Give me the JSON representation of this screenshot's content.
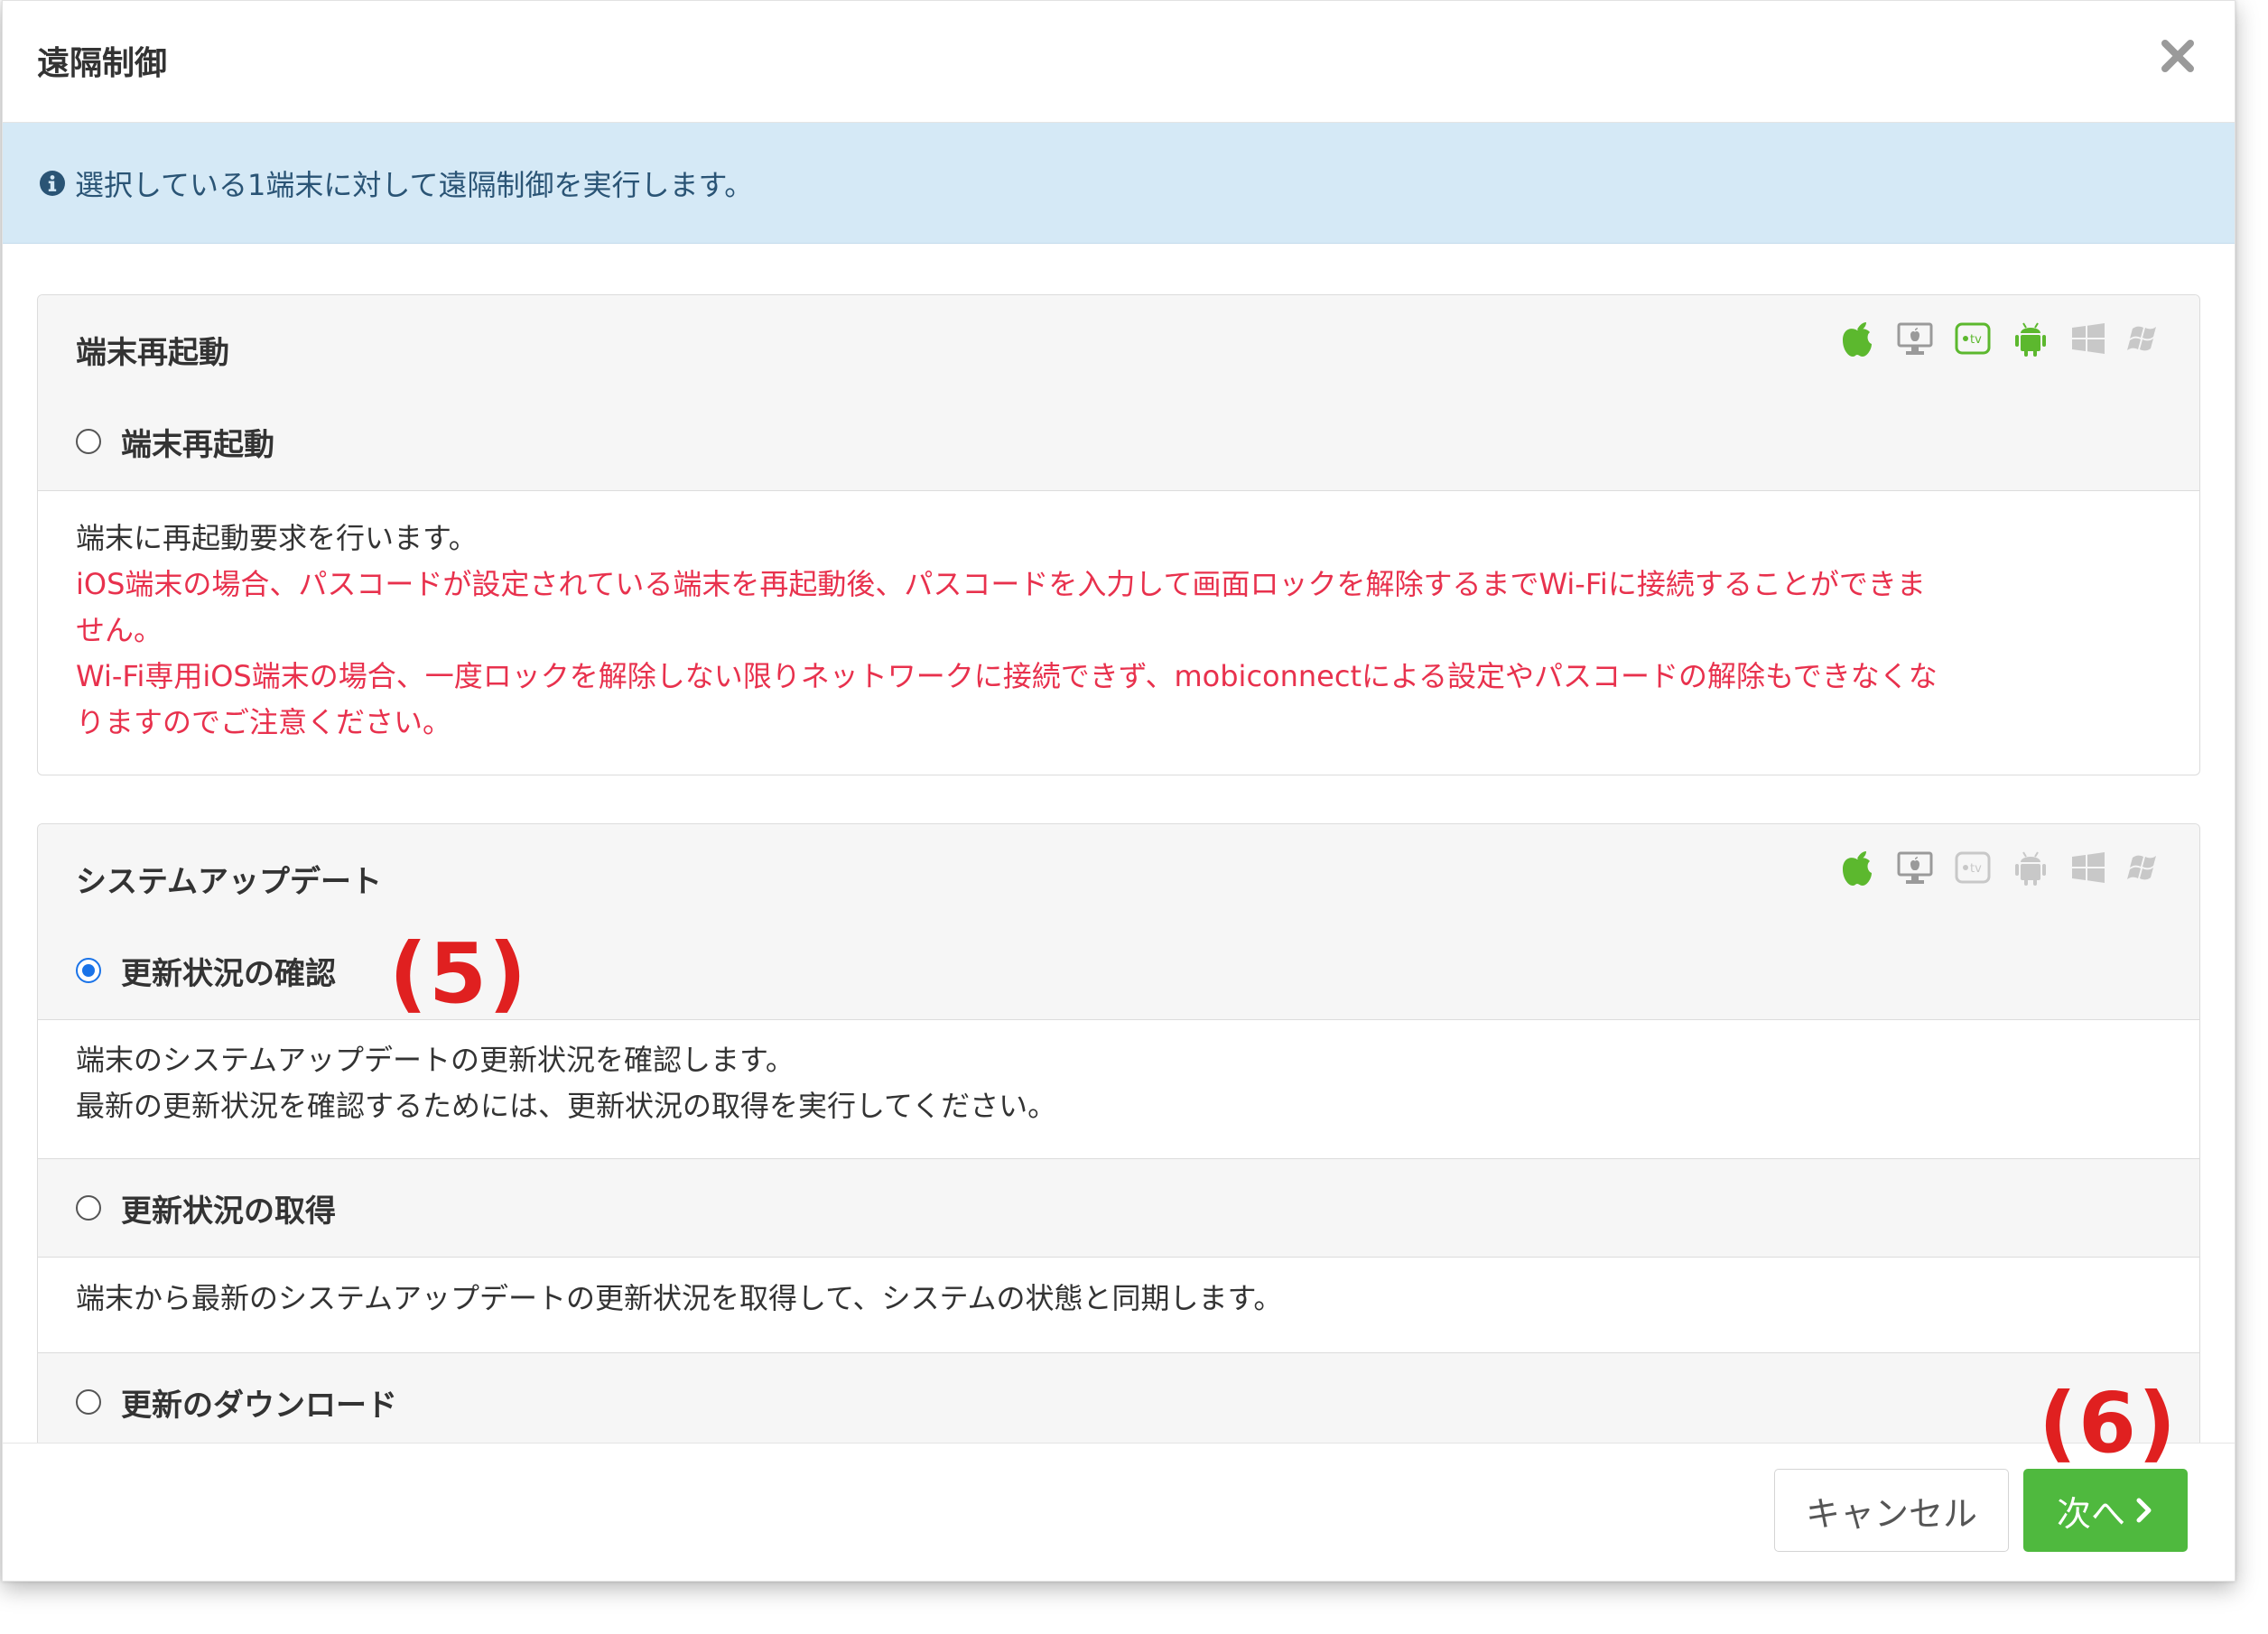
{
  "modal": {
    "title": "遠隔制御"
  },
  "alert": {
    "text": "選択している1端末に対して遠隔制御を実行します。"
  },
  "panels": [
    {
      "title": "端末再起動",
      "os_support": [
        "apple",
        "mac",
        "apple-tv",
        "android",
        "windows",
        "windows-legacy"
      ],
      "options": [
        {
          "label": "端末再起動",
          "selected": false,
          "description": "端末に再起動要求を行います。",
          "warnings": [
            "iOS端末の場合、パスコードが設定されている端末を再起動後、パスコードを入力して画面ロックを解除するまでWi-Fiに接続することができま",
            "せん。",
            "Wi-Fi専用iOS端末の場合、一度ロックを解除しない限りネットワークに接続できず、mobiconnectによる設定やパスコードの解除もできなくな",
            "りますのでご注意ください。"
          ]
        }
      ]
    },
    {
      "title": "システムアップデート",
      "os_support": [
        "apple",
        "mac"
      ],
      "options": [
        {
          "label": "更新状況の確認",
          "selected": true,
          "description_lines": [
            "端末のシステムアップデートの更新状況を確認します。",
            "最新の更新状況を確認するためには、更新状況の取得を実行してください。"
          ]
        },
        {
          "label": "更新状況の取得",
          "selected": false,
          "description_lines": [
            "端末から最新のシステムアップデートの更新状況を取得して、システムの状態と同期します。"
          ]
        },
        {
          "label": "更新のダウンロード",
          "selected": false
        }
      ]
    }
  ],
  "annotations": {
    "step5": "(5)",
    "step6": "(6)"
  },
  "footer": {
    "cancel_label": "キャンセル",
    "next_label": "次へ"
  },
  "colors": {
    "alert_bg": "#d5e9f6",
    "warning_text": "#e8314d",
    "supported_icon": "#5cb82e",
    "unsupported_icon": "#c8c8c8",
    "primary_button": "#4fb93e",
    "radio_checked": "#1a73e8",
    "annotation": "#e02020"
  }
}
